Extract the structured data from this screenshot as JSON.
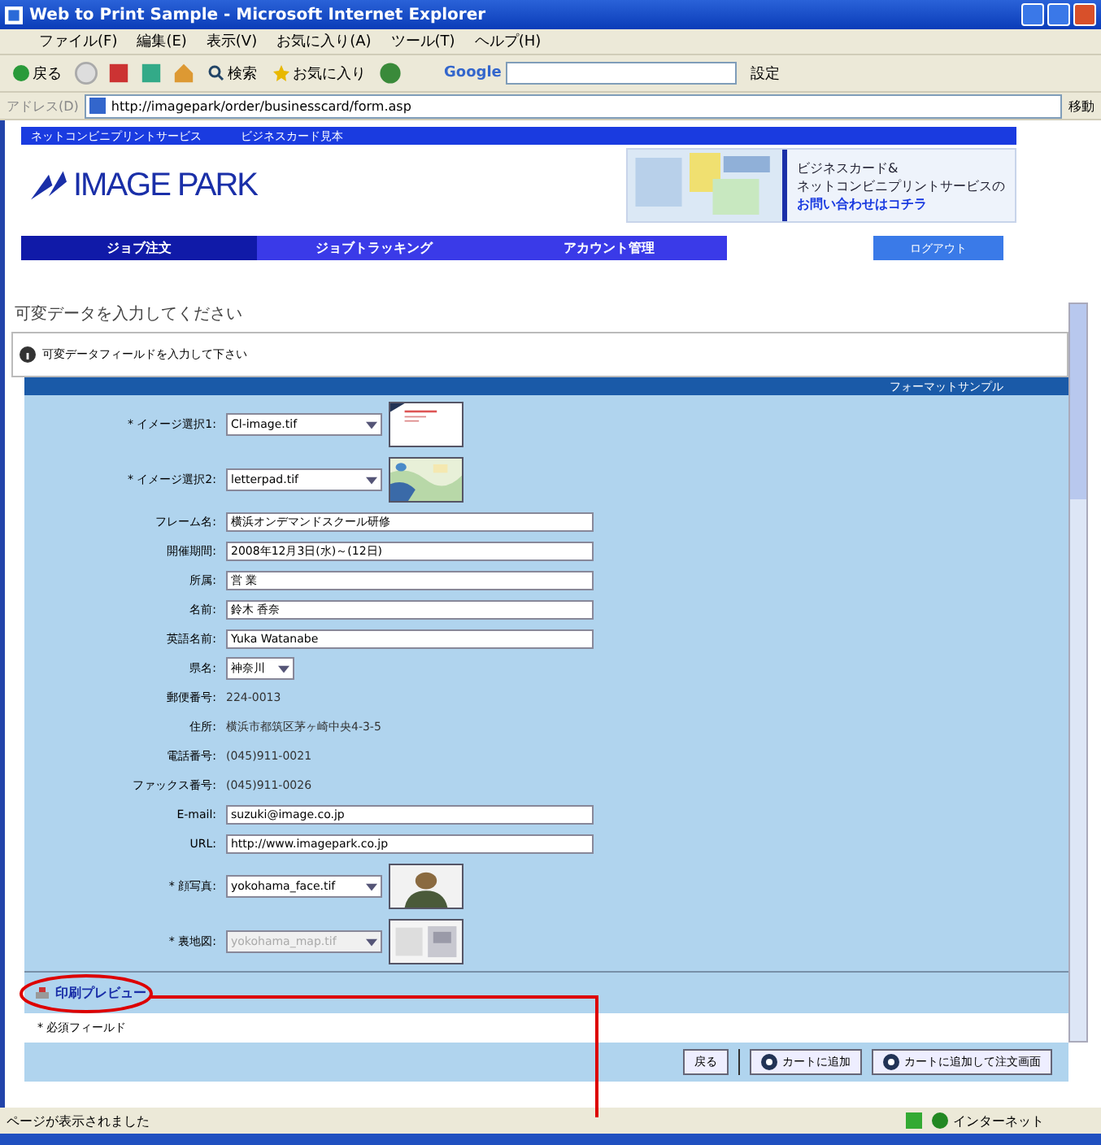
{
  "window": {
    "title": "Web to Print Sample - Microsoft Internet Explorer"
  },
  "menu": [
    "ファイル(F)",
    "編集(E)",
    "表示(V)",
    "お気に入り(A)",
    "ツール(T)",
    "ヘルプ(H)"
  ],
  "toolbar": {
    "back": "戻る",
    "search": "検索",
    "favorites": "お気に入り",
    "google": "Google",
    "settings": "設定"
  },
  "address": {
    "label": "アドレス(D)",
    "url": "http://imagepark/order/businesscard/form.asp",
    "go": "移動"
  },
  "site": {
    "top_links": [
      "ネットコンビニプリントサービス",
      "ビジネスカード見本"
    ],
    "logo": "IMAGE PARK",
    "banner": [
      "ビジネスカード&",
      "ネットコンビニプリントサービスの",
      "お問い合わせはコチラ"
    ],
    "nav": [
      {
        "label": "ジョブ注文",
        "selected": true
      },
      {
        "label": "ジョブトラッキング",
        "selected": false
      },
      {
        "label": "アカウント管理",
        "selected": false
      }
    ],
    "logout": "ログアウト"
  },
  "heading": "可変データを入力してください",
  "info": "可変データフィールドを入力して下さい",
  "panel_title": "フォーマットサンプル",
  "rows": [
    {
      "label": "* イメージ選択1:",
      "kind": "select",
      "value": "Cl-image.tif",
      "disabled": false
    },
    {
      "label": "* イメージ選択2:",
      "kind": "select",
      "value": "letterpad.tif",
      "disabled": false
    },
    {
      "label": "フレーム名:",
      "kind": "input",
      "value": "横浜オンデマンドスクール研修",
      "disabled": false
    },
    {
      "label": "開催期間:",
      "kind": "input",
      "value": "2008年12月3日(水)～(12日)",
      "disabled": false
    },
    {
      "label": "所属:",
      "kind": "input",
      "value": "営 業",
      "disabled": false
    },
    {
      "label": "名前:",
      "kind": "input",
      "value": "鈴木 香奈",
      "disabled": false
    },
    {
      "label": "英語名前:",
      "kind": "input",
      "value": "Yuka Watanabe",
      "disabled": false
    },
    {
      "label": "県名:",
      "kind": "small-select",
      "value": "神奈川",
      "disabled": false
    },
    {
      "label": "郵便番号:",
      "kind": "static",
      "value": "224-0013"
    },
    {
      "label": "住所:",
      "kind": "static",
      "value": "横浜市都筑区茅ヶ崎中央4-3-5"
    },
    {
      "label": "電話番号:",
      "kind": "static",
      "value": "(045)911-0021"
    },
    {
      "label": "ファックス番号:",
      "kind": "static",
      "value": "(045)911-0026"
    },
    {
      "label": "E-mail:",
      "kind": "input",
      "value": "suzuki@image.co.jp",
      "disabled": false
    },
    {
      "label": "URL:",
      "kind": "input",
      "value": "http://www.imagepark.co.jp",
      "disabled": false
    },
    {
      "label": "* 顔写真:",
      "kind": "select",
      "value": "yokohama_face.tif",
      "disabled": false
    },
    {
      "label": "* 裏地図:",
      "kind": "select",
      "value": "yokohama_map.tif",
      "disabled": true
    }
  ],
  "preview_link": "印刷プレビュー",
  "required_note": "* 必須フィールド",
  "buttons": [
    "戻る",
    "カートに追加",
    "カートに追加して注文画面"
  ],
  "status_bar": {
    "text": "ページが表示されました",
    "zone": "インターネット"
  }
}
